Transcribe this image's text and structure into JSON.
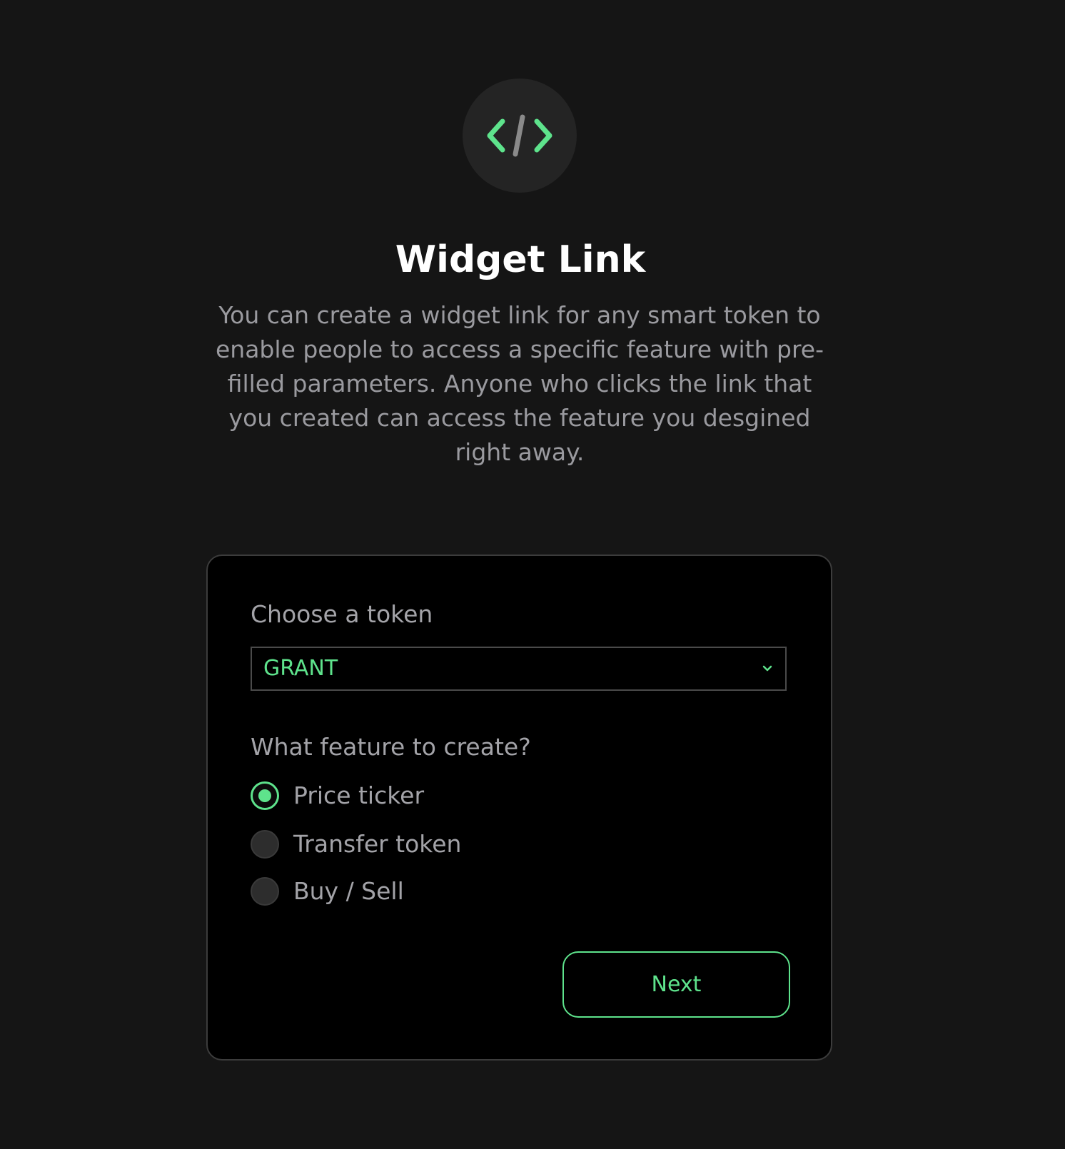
{
  "hero": {
    "icon": "code-icon",
    "title": "Widget Link",
    "description": "You can create a widget link for any smart token to enable people to access a specific feature with pre-filled parameters. Anyone who clicks the link that you created can access the feature you desgined right away."
  },
  "form": {
    "token_label": "Choose a token",
    "token_value": "GRANT",
    "feature_label": "What feature to create?",
    "features": [
      {
        "label": "Price ticker",
        "selected": true
      },
      {
        "label": "Transfer token",
        "selected": false
      },
      {
        "label": "Buy / Sell",
        "selected": false
      }
    ],
    "next_label": "Next"
  },
  "colors": {
    "background": "#151515",
    "card": "#000000",
    "accent": "#5ee38c",
    "muted_text": "#a3a3a8"
  }
}
